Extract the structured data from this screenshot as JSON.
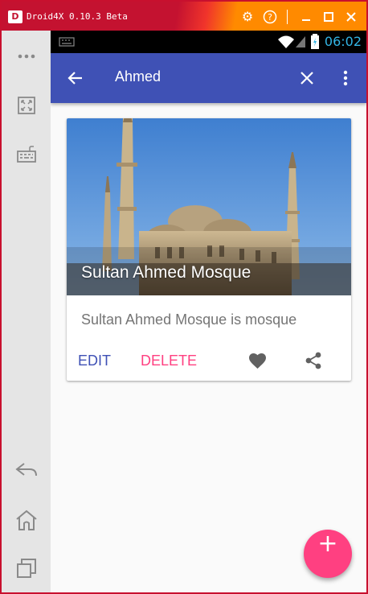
{
  "window": {
    "app_title": "Droid4X 0.10.3 Beta",
    "logo_text": "D",
    "controls": [
      "gear-icon",
      "help-icon",
      "minimize-icon",
      "maximize-icon",
      "close-icon"
    ]
  },
  "sidebar": {
    "items": [
      "more-icon",
      "fullscreen-icon",
      "keyboard-icon",
      "back-icon",
      "home-icon",
      "recents-icon"
    ]
  },
  "statusbar": {
    "time": "06:02",
    "icons": [
      "keyboard-icon",
      "wifi-icon",
      "signal-icon",
      "battery-icon"
    ]
  },
  "appbar": {
    "search_query": "Ahmed",
    "color": "#3f51b5"
  },
  "card": {
    "title": "Sultan Ahmed Mosque",
    "description": "Sultan Ahmed Mosque is mosque",
    "edit_label": "EDIT",
    "delete_label": "DELETE",
    "edit_color": "#3f51b5",
    "delete_color": "#ff4081"
  },
  "fab": {
    "label": "+",
    "color": "#ff4081"
  }
}
